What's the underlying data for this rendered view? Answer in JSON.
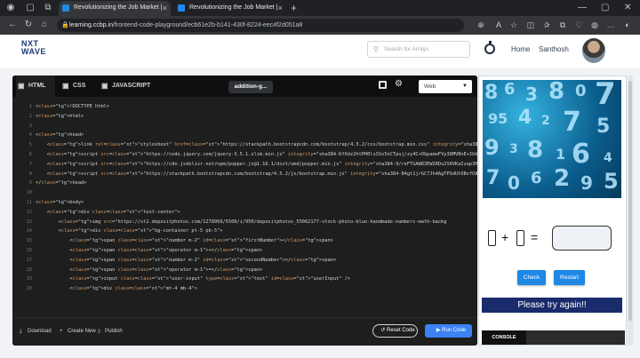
{
  "browser": {
    "tabs": [
      {
        "title": "Revolutionizing the Job Market |",
        "active": true
      },
      {
        "title": "Revolutionizing the Job Market |",
        "active": false
      }
    ],
    "url_host": "learning.ccbp.in",
    "url_path": "/frontend-code-playground/ecb61e2b-b141-430f-8224-eec4f2d051a8"
  },
  "header": {
    "logo_line1": "NXT",
    "logo_line2": "WAVE",
    "search_placeholder": "Search for Arrays",
    "nav_home": "Home",
    "user_name": "Santhosh"
  },
  "editor": {
    "tabs": [
      {
        "label": "HTML",
        "icon": "html5-icon"
      },
      {
        "label": "CSS",
        "icon": "css3-icon"
      },
      {
        "label": "JAVASCRIPT",
        "icon": "js-icon"
      }
    ],
    "file_tab": "addition-g...",
    "theme": "Web",
    "code_lines": [
      "<!DOCTYPE html>",
      "<html>",
      "",
      "<head>",
      "    <link rel=\"stylesheet\" href=\"https://stackpath.bootstrapcdn.com/bootstrap/4.5.2/css/bootstrap.min.css\" integrity=\"sha384-JcKb8q3iq",
      "    <script src=\"https://code.jquery.com/jquery-3.5.1.slim.min.js\" integrity=\"sha384-DfXdz2htPH0lsSSs5nCTpuj/zy4C+OGpamoFVy38MVBnE+IbbV",
      "    <script src=\"https://cdn.jsdelivr.net/npm/popper.js@1.16.1/dist/umd/popper.min.js\" integrity=\"sha384-9/reFTGAW83EW2RDu2S0VKaIzap3H",
      "    <script src=\"https://stackpath.bootstrapcdn.com/bootstrap/4.5.2/js/bootstrap.min.js\" integrity=\"sha384-B4gt1jrGC7Jh4AgTPSdUtOBvfO8",
      "</head>",
      "",
      "<body>",
      "    <div class=\"text-center\">",
      "        <img src=\"https://st2.depositphotos.com/1278969/5508/i/950/depositphotos_55062177-stock-photo-blue-handmade-numbers-math-backg",
      "        <div class=\"bg-container pt-5 pb-5\">",
      "            <span class=\"number m-2\" id=\"firstNumber\"></span>",
      "            <span class=\"operator m-1\">+</span>",
      "            <span class=\"number m-2\" id=\"secondNumber\"></span>",
      "            <span class=\"operator m-1\">=</span>",
      "            <input class=\"user-input\" type=\"text\" id=\"userInput\" />",
      "            <div class=\"mt-4 mb-4\">"
    ],
    "footer": {
      "download": "Download",
      "create_new": "Create New",
      "publish": "Publish",
      "reset": "Reset Code",
      "run": "Run Code"
    }
  },
  "preview": {
    "plus": "+",
    "equals": "=",
    "check": "Check",
    "restart": "Restart",
    "result": "Please try again!!",
    "console": "CONSOLE"
  }
}
